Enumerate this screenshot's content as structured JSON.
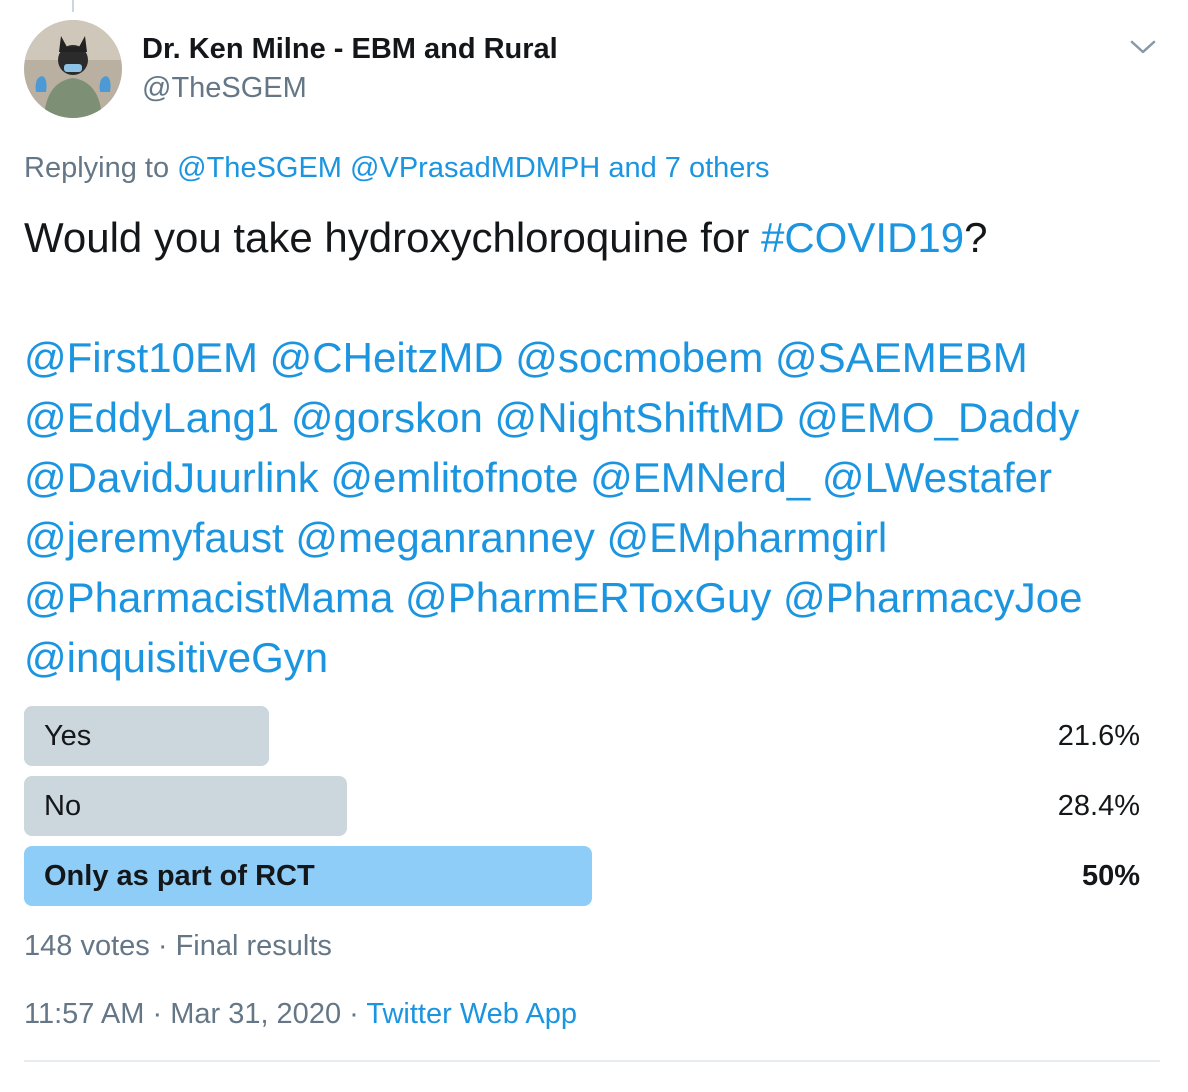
{
  "author": {
    "name": "Dr. Ken Milne - EBM and Rural",
    "handle": "@TheSGEM",
    "avatar_icon": "avatar-icon"
  },
  "menu_icon": "chevron-down-icon",
  "reply": {
    "prefix": "Replying to",
    "mentions": [
      "@TheSGEM",
      "@VPrasadMDMPH",
      "and 7 others"
    ]
  },
  "tweet": {
    "text_before": "Would you take hydroxychloroquine for ",
    "hashtag": "#COVID19",
    "text_after": "?",
    "mention_lines": [
      "@First10EM @CHeitzMD @socmobem @SAEMEBM",
      "@EddyLang1 @gorskon @NightShiftMD @EMO_Daddy",
      "@DavidJuurlink @emlitofnote @EMNerd_ @LWestafer",
      "@jeremyfaust @meganranney @EMpharmgirl",
      "@PharmacistMama @PharmERToxGuy @PharmacyJoe",
      "@inquisitiveGyn"
    ]
  },
  "poll": {
    "options": [
      {
        "label": "Yes",
        "percent_text": "21.6%",
        "fraction": 0.216,
        "winner": false
      },
      {
        "label": "No",
        "percent_text": "28.4%",
        "fraction": 0.284,
        "winner": false
      },
      {
        "label": "Only as part of RCT",
        "percent_text": "50%",
        "fraction": 0.5,
        "winner": true
      }
    ],
    "votes": "148 votes",
    "separator": "·",
    "status": "Final results"
  },
  "meta": {
    "time": "11:57 AM",
    "separator": "·",
    "date": "Mar 31, 2020",
    "source": "Twitter Web App"
  },
  "colors": {
    "link": "#1b95e0",
    "muted": "#657786",
    "text": "#14171a",
    "poll_bar": "#ccd6dd",
    "poll_winner": "#8ecdf8"
  }
}
